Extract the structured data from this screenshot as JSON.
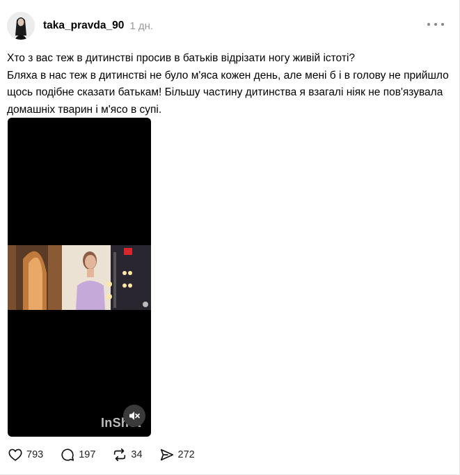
{
  "post": {
    "username": "taka_pravda_90",
    "time": "1 дн.",
    "text": "Хто з вас теж в дитинстві просив в батьків відрізати ногу живій істоті?\nБляха в нас теж в дитинстві не було м'яса кожен день, але мені б і в голову не прийшло щось подібне сказати батькам! Більшу частину дитинства я взагалі ніяк не пов'язувала домашніх тварин і м'ясо в супі.",
    "video": {
      "watermark": "InShot",
      "muted": true
    },
    "stats": {
      "likes": "793",
      "replies": "197",
      "reposts": "34",
      "shares": "272"
    }
  },
  "icons": {
    "more": "more-horizontal-icon",
    "like": "heart-icon",
    "reply": "comment-icon",
    "repost": "repost-icon",
    "share": "send-icon",
    "mute": "speaker-muted-icon"
  }
}
